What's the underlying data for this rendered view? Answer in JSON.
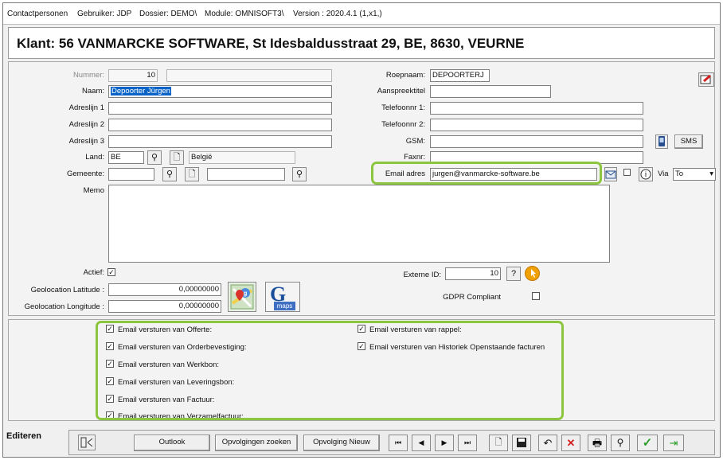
{
  "titlebar": {
    "form": "Contactpersonen",
    "user": "Gebruiker: JDP",
    "dossier": "Dossier: DEMO\\",
    "module": "Module: OMNISOFT3\\",
    "version": "Version : 2020.4.1 (1,x1,)"
  },
  "header": {
    "klant": "Klant: 56 VANMARCKE SOFTWARE, St Idesbaldusstraat 29, BE, 8630, VEURNE"
  },
  "left": {
    "nummer_label": "Nummer:",
    "nummer_value": "10",
    "naam_label": "Naam:",
    "naam_value": "Depoorter Jürgen",
    "adres1_label": "Adreslijn 1",
    "adres2_label": "Adreslijn 2",
    "adres3_label": "Adreslijn 3",
    "land_label": "Land:",
    "land_code": "BE",
    "land_name": "België",
    "gemeente_label": "Gemeente:",
    "memo_label": "Memo",
    "actief_label": "Actief:",
    "actief_check": "✓",
    "lat_label": "Geolocation Latitude :",
    "lat_value": "0,00000000",
    "lon_label": "Geolocation Longitude :",
    "lon_value": "0,00000000",
    "gmaps_letter": "G",
    "gmaps_text": "maps"
  },
  "right": {
    "roepnaam_label": "Roepnaam:",
    "roepnaam_value": "DEPOORTERJ",
    "aanspreektitel_label": "Aanspreektitel",
    "tel1_label": "Telefoonnr 1:",
    "tel2_label": "Telefoonnr 2:",
    "gsm_label": "GSM:",
    "sms_label": "SMS",
    "faxnr_label": "Faxnr:",
    "email_label": "Email adres",
    "email_value": "jurgen@vanmarcke-software.be",
    "via_label": "Via",
    "via_value": "To",
    "externe_label": "Externe ID:",
    "externe_value": "10",
    "gdpr_label": "GDPR Compliant"
  },
  "emails": {
    "check": "✓",
    "offerte": "Email versturen van Offerte:",
    "orderbevestiging": "Email versturen van Orderbevestiging:",
    "werkbon": "Email versturen van Werkbon:",
    "leveringsbon": "Email versturen van Leveringsbon:",
    "factuur": "Email versturen van Factuur:",
    "verzamelfactuur": "Email versturen van Verzamelfactuur:",
    "rappel": "Email versturen van rappel:",
    "historiek": "Email versturen van Historiek Openstaande facturen"
  },
  "bottom": {
    "mode": "Editeren",
    "outlook": "Outlook",
    "opvolgingen_zoeken": "Opvolgingen zoeken",
    "opvolging_nieuw": "Opvolging Nieuw"
  },
  "icons": {
    "search": "⚲",
    "document": "🗋",
    "help": "?",
    "first": "⏮",
    "prev": "◀",
    "next": "▶",
    "last": "⏭",
    "undo": "↶",
    "delete": "✕",
    "print": "🖶",
    "confirm": "✓",
    "exit": "⇥",
    "dropdown": "▾"
  },
  "colors": {
    "highlight": "#8cc63f",
    "selection": "#0a64c8",
    "delete_red": "#d22020",
    "confirm_green": "#2a9a2a",
    "cursor_orange": "#f0a000"
  }
}
